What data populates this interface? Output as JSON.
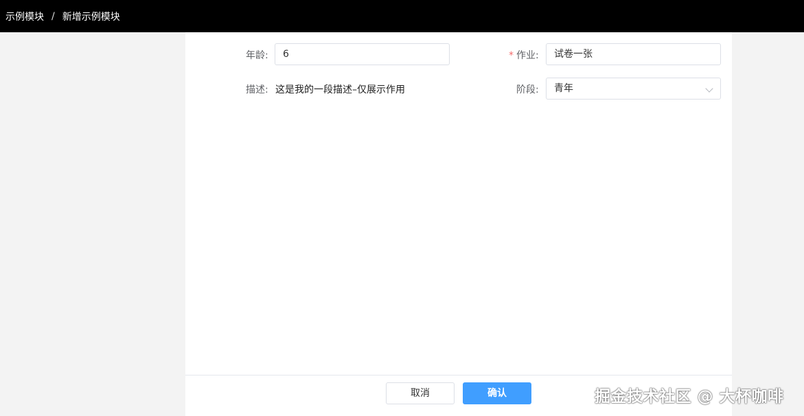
{
  "breadcrumb": {
    "items": [
      "示例模块",
      "新增示例模块"
    ],
    "separator": "/"
  },
  "form": {
    "age": {
      "label": "年龄:",
      "value": "6"
    },
    "homework": {
      "required_mark": "*",
      "label": "作业:",
      "value": "试卷一张"
    },
    "description": {
      "label": "描述:",
      "value": "这是我的一段描述–仅展示作用"
    },
    "stage": {
      "label": "阶段:",
      "value": "青年"
    }
  },
  "footer": {
    "cancel_label": "取消",
    "confirm_label": "确认"
  },
  "watermark": "掘金技术社区 @ 大杯咖啡",
  "colors": {
    "topbar_bg": "#000000",
    "primary": "#409eff",
    "required": "#f56c6c",
    "page_bg": "#f3f3f3"
  },
  "icons": {
    "stage_select": "chevron-down-icon"
  }
}
